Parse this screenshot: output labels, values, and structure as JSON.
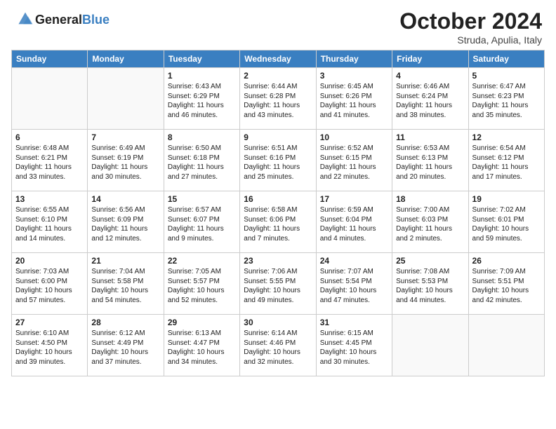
{
  "header": {
    "logo_general": "General",
    "logo_blue": "Blue",
    "month": "October 2024",
    "location": "Struda, Apulia, Italy"
  },
  "days": [
    "Sunday",
    "Monday",
    "Tuesday",
    "Wednesday",
    "Thursday",
    "Friday",
    "Saturday"
  ],
  "cells": [
    [
      {
        "num": "",
        "lines": [],
        "shade": true
      },
      {
        "num": "",
        "lines": [],
        "shade": true
      },
      {
        "num": "1",
        "lines": [
          "Sunrise: 6:43 AM",
          "Sunset: 6:29 PM",
          "Daylight: 11 hours",
          "and 46 minutes."
        ]
      },
      {
        "num": "2",
        "lines": [
          "Sunrise: 6:44 AM",
          "Sunset: 6:28 PM",
          "Daylight: 11 hours",
          "and 43 minutes."
        ]
      },
      {
        "num": "3",
        "lines": [
          "Sunrise: 6:45 AM",
          "Sunset: 6:26 PM",
          "Daylight: 11 hours",
          "and 41 minutes."
        ]
      },
      {
        "num": "4",
        "lines": [
          "Sunrise: 6:46 AM",
          "Sunset: 6:24 PM",
          "Daylight: 11 hours",
          "and 38 minutes."
        ]
      },
      {
        "num": "5",
        "lines": [
          "Sunrise: 6:47 AM",
          "Sunset: 6:23 PM",
          "Daylight: 11 hours",
          "and 35 minutes."
        ]
      }
    ],
    [
      {
        "num": "6",
        "lines": [
          "Sunrise: 6:48 AM",
          "Sunset: 6:21 PM",
          "Daylight: 11 hours",
          "and 33 minutes."
        ]
      },
      {
        "num": "7",
        "lines": [
          "Sunrise: 6:49 AM",
          "Sunset: 6:19 PM",
          "Daylight: 11 hours",
          "and 30 minutes."
        ]
      },
      {
        "num": "8",
        "lines": [
          "Sunrise: 6:50 AM",
          "Sunset: 6:18 PM",
          "Daylight: 11 hours",
          "and 27 minutes."
        ]
      },
      {
        "num": "9",
        "lines": [
          "Sunrise: 6:51 AM",
          "Sunset: 6:16 PM",
          "Daylight: 11 hours",
          "and 25 minutes."
        ]
      },
      {
        "num": "10",
        "lines": [
          "Sunrise: 6:52 AM",
          "Sunset: 6:15 PM",
          "Daylight: 11 hours",
          "and 22 minutes."
        ]
      },
      {
        "num": "11",
        "lines": [
          "Sunrise: 6:53 AM",
          "Sunset: 6:13 PM",
          "Daylight: 11 hours",
          "and 20 minutes."
        ]
      },
      {
        "num": "12",
        "lines": [
          "Sunrise: 6:54 AM",
          "Sunset: 6:12 PM",
          "Daylight: 11 hours",
          "and 17 minutes."
        ]
      }
    ],
    [
      {
        "num": "13",
        "lines": [
          "Sunrise: 6:55 AM",
          "Sunset: 6:10 PM",
          "Daylight: 11 hours",
          "and 14 minutes."
        ]
      },
      {
        "num": "14",
        "lines": [
          "Sunrise: 6:56 AM",
          "Sunset: 6:09 PM",
          "Daylight: 11 hours",
          "and 12 minutes."
        ]
      },
      {
        "num": "15",
        "lines": [
          "Sunrise: 6:57 AM",
          "Sunset: 6:07 PM",
          "Daylight: 11 hours",
          "and 9 minutes."
        ]
      },
      {
        "num": "16",
        "lines": [
          "Sunrise: 6:58 AM",
          "Sunset: 6:06 PM",
          "Daylight: 11 hours",
          "and 7 minutes."
        ]
      },
      {
        "num": "17",
        "lines": [
          "Sunrise: 6:59 AM",
          "Sunset: 6:04 PM",
          "Daylight: 11 hours",
          "and 4 minutes."
        ]
      },
      {
        "num": "18",
        "lines": [
          "Sunrise: 7:00 AM",
          "Sunset: 6:03 PM",
          "Daylight: 11 hours",
          "and 2 minutes."
        ]
      },
      {
        "num": "19",
        "lines": [
          "Sunrise: 7:02 AM",
          "Sunset: 6:01 PM",
          "Daylight: 10 hours",
          "and 59 minutes."
        ]
      }
    ],
    [
      {
        "num": "20",
        "lines": [
          "Sunrise: 7:03 AM",
          "Sunset: 6:00 PM",
          "Daylight: 10 hours",
          "and 57 minutes."
        ]
      },
      {
        "num": "21",
        "lines": [
          "Sunrise: 7:04 AM",
          "Sunset: 5:58 PM",
          "Daylight: 10 hours",
          "and 54 minutes."
        ]
      },
      {
        "num": "22",
        "lines": [
          "Sunrise: 7:05 AM",
          "Sunset: 5:57 PM",
          "Daylight: 10 hours",
          "and 52 minutes."
        ]
      },
      {
        "num": "23",
        "lines": [
          "Sunrise: 7:06 AM",
          "Sunset: 5:55 PM",
          "Daylight: 10 hours",
          "and 49 minutes."
        ]
      },
      {
        "num": "24",
        "lines": [
          "Sunrise: 7:07 AM",
          "Sunset: 5:54 PM",
          "Daylight: 10 hours",
          "and 47 minutes."
        ]
      },
      {
        "num": "25",
        "lines": [
          "Sunrise: 7:08 AM",
          "Sunset: 5:53 PM",
          "Daylight: 10 hours",
          "and 44 minutes."
        ]
      },
      {
        "num": "26",
        "lines": [
          "Sunrise: 7:09 AM",
          "Sunset: 5:51 PM",
          "Daylight: 10 hours",
          "and 42 minutes."
        ]
      }
    ],
    [
      {
        "num": "27",
        "lines": [
          "Sunrise: 6:10 AM",
          "Sunset: 4:50 PM",
          "Daylight: 10 hours",
          "and 39 minutes."
        ]
      },
      {
        "num": "28",
        "lines": [
          "Sunrise: 6:12 AM",
          "Sunset: 4:49 PM",
          "Daylight: 10 hours",
          "and 37 minutes."
        ]
      },
      {
        "num": "29",
        "lines": [
          "Sunrise: 6:13 AM",
          "Sunset: 4:47 PM",
          "Daylight: 10 hours",
          "and 34 minutes."
        ]
      },
      {
        "num": "30",
        "lines": [
          "Sunrise: 6:14 AM",
          "Sunset: 4:46 PM",
          "Daylight: 10 hours",
          "and 32 minutes."
        ]
      },
      {
        "num": "31",
        "lines": [
          "Sunrise: 6:15 AM",
          "Sunset: 4:45 PM",
          "Daylight: 10 hours",
          "and 30 minutes."
        ]
      },
      {
        "num": "",
        "lines": [],
        "shade": true
      },
      {
        "num": "",
        "lines": [],
        "shade": true
      }
    ]
  ]
}
